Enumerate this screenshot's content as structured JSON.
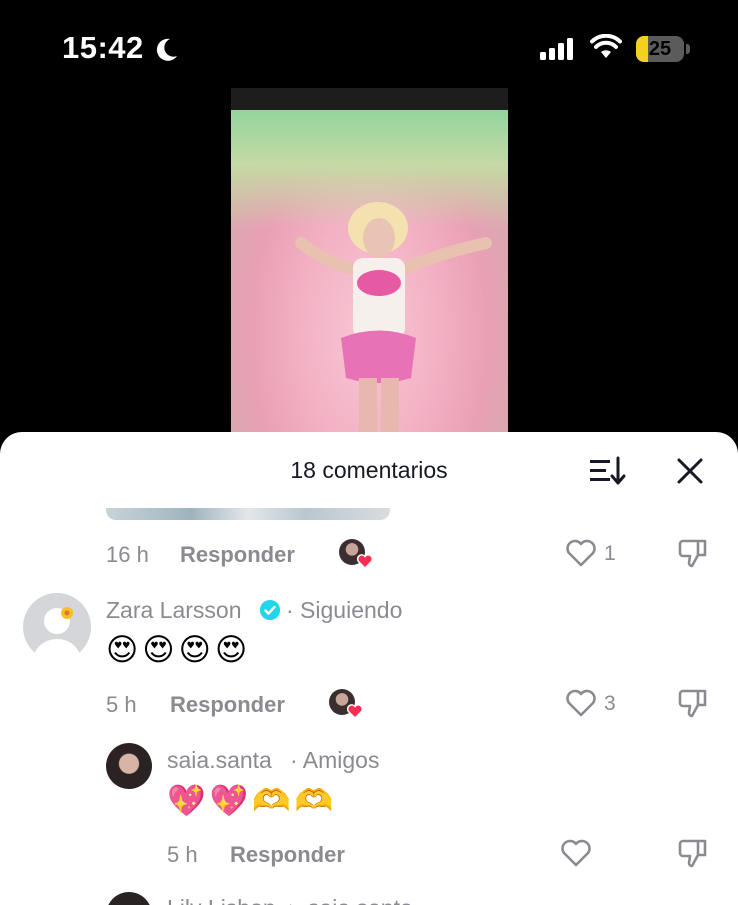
{
  "status_bar": {
    "time": "15:42",
    "battery": "25",
    "battery_level": 0.25
  },
  "sheet": {
    "title": "18 comentarios"
  },
  "comments": [
    {
      "age": "16 h",
      "reply_label": "Responder",
      "likes": "1"
    },
    {
      "author": "Zara Larsson",
      "relation": "· Siguiendo",
      "text": "😍😍😍😍",
      "age": "5 h",
      "reply_label": "Responder",
      "likes": "3"
    },
    {
      "author": "saia.santa",
      "relation": "· Amigos",
      "text": "💖💖🫶🫶",
      "age": "5 h",
      "reply_label": "Responder",
      "likes": ""
    },
    {
      "author": "Lily Lisbon",
      "relation": "▸ saia.santa"
    }
  ],
  "colors": {
    "accent_heart": "#fe2c55",
    "verified": "#20d5ec",
    "muted": "#8a8b91",
    "title": "#161823"
  }
}
